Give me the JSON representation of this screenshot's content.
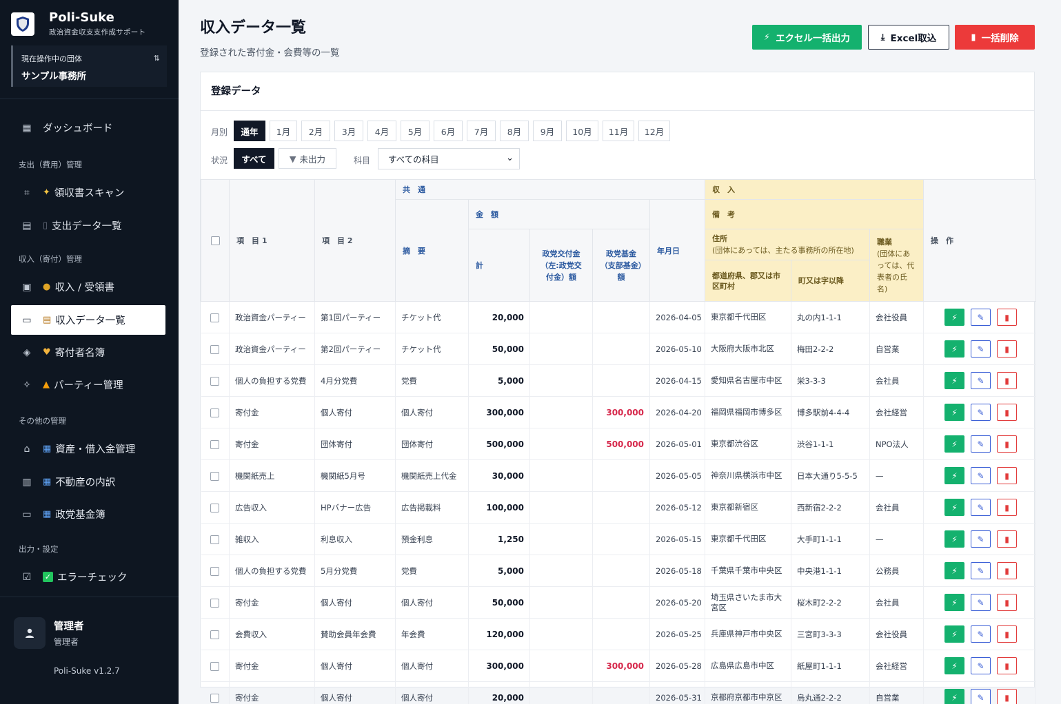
{
  "brand": {
    "name": "Poli-Suke",
    "subtitle": "政治資金収支支作成サポート"
  },
  "org": {
    "label": "現在操作中の団体",
    "name": "サンプル事務所"
  },
  "nav": {
    "dashboard": "ダッシュボード",
    "section_expense": "支出（費用）管理",
    "receipt_scan": "領収書スキャン",
    "expense_list": "支出データ一覧",
    "section_income": "収入（寄付）管理",
    "income_receipt": "収入 / 受領書",
    "income_list": "収入データ一覧",
    "donor_list": "寄付者名簿",
    "party_mgmt": "パーティー管理",
    "section_other": "その他の管理",
    "assets": "資産・借入金管理",
    "realestate": "不動産の内訳",
    "fund": "政党基金簿",
    "section_output": "出力・設定",
    "error_check": "エラーチェック"
  },
  "user": {
    "name": "管理者",
    "role": "管理者"
  },
  "version": "Poli-Suke v1.2.7",
  "page": {
    "title": "収入データ一覧",
    "subtitle": "登録された寄付金・会費等の一覧"
  },
  "actions": {
    "export_excel": "エクセル一括出力",
    "import_excel": "Excel取込",
    "bulk_delete": "一括削除"
  },
  "card": {
    "title": "登録データ"
  },
  "filters": {
    "month_label": "月別",
    "months": [
      "通年",
      "1月",
      "2月",
      "3月",
      "4月",
      "5月",
      "6月",
      "7月",
      "8月",
      "9月",
      "10月",
      "11月",
      "12月"
    ],
    "status_label": "状況",
    "status_all": "すべて",
    "status_unexported": "未出力",
    "subject_label": "科目",
    "subject_value": "すべての科目"
  },
  "table": {
    "h_common": "共　通",
    "h_income": "収　入",
    "h_item1": "項　目 1",
    "h_item2": "項　目 2",
    "h_amount": "金　額",
    "h_summary": "摘　要",
    "h_total": "計",
    "h_party_grant": "政党交付金（左:政党交付金）額",
    "h_party_fund": "政党基金（支部基金）額",
    "h_date": "年月日",
    "h_remarks": "備　考",
    "h_address": "住所",
    "h_address_note": "(団体にあっては、主たる事務所の所在地)",
    "h_pref": "都道府県、郡又は市区町村",
    "h_town": "町又は字以降",
    "h_job": "職業",
    "h_job_note": "(団体にあっては、代表者の氏名)",
    "h_ops": "操　作",
    "rows": [
      {
        "item1": "政治資金パーティー",
        "item2": "第1回パーティー",
        "summary": "チケット代",
        "total": "20,000",
        "grant": "",
        "fund": "",
        "date": "2026-04-05",
        "pref": "東京都千代田区",
        "town": "丸の内1-1-1",
        "job": "会社役員"
      },
      {
        "item1": "政治資金パーティー",
        "item2": "第2回パーティー",
        "summary": "チケット代",
        "total": "50,000",
        "grant": "",
        "fund": "",
        "date": "2026-05-10",
        "pref": "大阪府大阪市北区",
        "town": "梅田2-2-2",
        "job": "自営業"
      },
      {
        "item1": "個人の負担する党費",
        "item2": "4月分党費",
        "summary": "党費",
        "total": "5,000",
        "grant": "",
        "fund": "",
        "date": "2026-04-15",
        "pref": "愛知県名古屋市中区",
        "town": "栄3-3-3",
        "job": "会社員"
      },
      {
        "item1": "寄付金",
        "item2": "個人寄付",
        "summary": "個人寄付",
        "total": "300,000",
        "grant": "",
        "fund": "300,000",
        "date": "2026-04-20",
        "pref": "福岡県福岡市博多区",
        "town": "博多駅前4-4-4",
        "job": "会社経営"
      },
      {
        "item1": "寄付金",
        "item2": "団体寄付",
        "summary": "団体寄付",
        "total": "500,000",
        "grant": "",
        "fund": "500,000",
        "date": "2026-05-01",
        "pref": "東京都渋谷区",
        "town": "渋谷1-1-1",
        "job": "NPO法人"
      },
      {
        "item1": "機関紙売上",
        "item2": "機関紙5月号",
        "summary": "機関紙売上代金",
        "total": "30,000",
        "grant": "",
        "fund": "",
        "date": "2026-05-05",
        "pref": "神奈川県横浜市中区",
        "town": "日本大通り5-5-5",
        "job": "—"
      },
      {
        "item1": "広告収入",
        "item2": "HPバナー広告",
        "summary": "広告掲載料",
        "total": "100,000",
        "grant": "",
        "fund": "",
        "date": "2026-05-12",
        "pref": "東京都新宿区",
        "town": "西新宿2-2-2",
        "job": "会社員"
      },
      {
        "item1": "雑収入",
        "item2": "利息収入",
        "summary": "預金利息",
        "total": "1,250",
        "grant": "",
        "fund": "",
        "date": "2026-05-15",
        "pref": "東京都千代田区",
        "town": "大手町1-1-1",
        "job": "—"
      },
      {
        "item1": "個人の負担する党費",
        "item2": "5月分党費",
        "summary": "党費",
        "total": "5,000",
        "grant": "",
        "fund": "",
        "date": "2026-05-18",
        "pref": "千葉県千葉市中央区",
        "town": "中央港1-1-1",
        "job": "公務員"
      },
      {
        "item1": "寄付金",
        "item2": "個人寄付",
        "summary": "個人寄付",
        "total": "50,000",
        "grant": "",
        "fund": "",
        "date": "2026-05-20",
        "pref": "埼玉県さいたま市大宮区",
        "town": "桜木町2-2-2",
        "job": "会社員"
      },
      {
        "item1": "会費収入",
        "item2": "賛助会員年会費",
        "summary": "年会費",
        "total": "120,000",
        "grant": "",
        "fund": "",
        "date": "2026-05-25",
        "pref": "兵庫県神戸市中央区",
        "town": "三宮町3-3-3",
        "job": "会社役員"
      },
      {
        "item1": "寄付金",
        "item2": "個人寄付",
        "summary": "個人寄付",
        "total": "300,000",
        "grant": "",
        "fund": "300,000",
        "date": "2026-05-28",
        "pref": "広島県広島市中区",
        "town": "紙屋町1-1-1",
        "job": "会社経営"
      },
      {
        "item1": "寄付金",
        "item2": "個人寄付",
        "summary": "個人寄付",
        "total": "20,000",
        "grant": "",
        "fund": "",
        "date": "2026-05-31",
        "pref": "京都府京都市中京区",
        "town": "烏丸通2-2-2",
        "job": "自営業"
      }
    ]
  }
}
